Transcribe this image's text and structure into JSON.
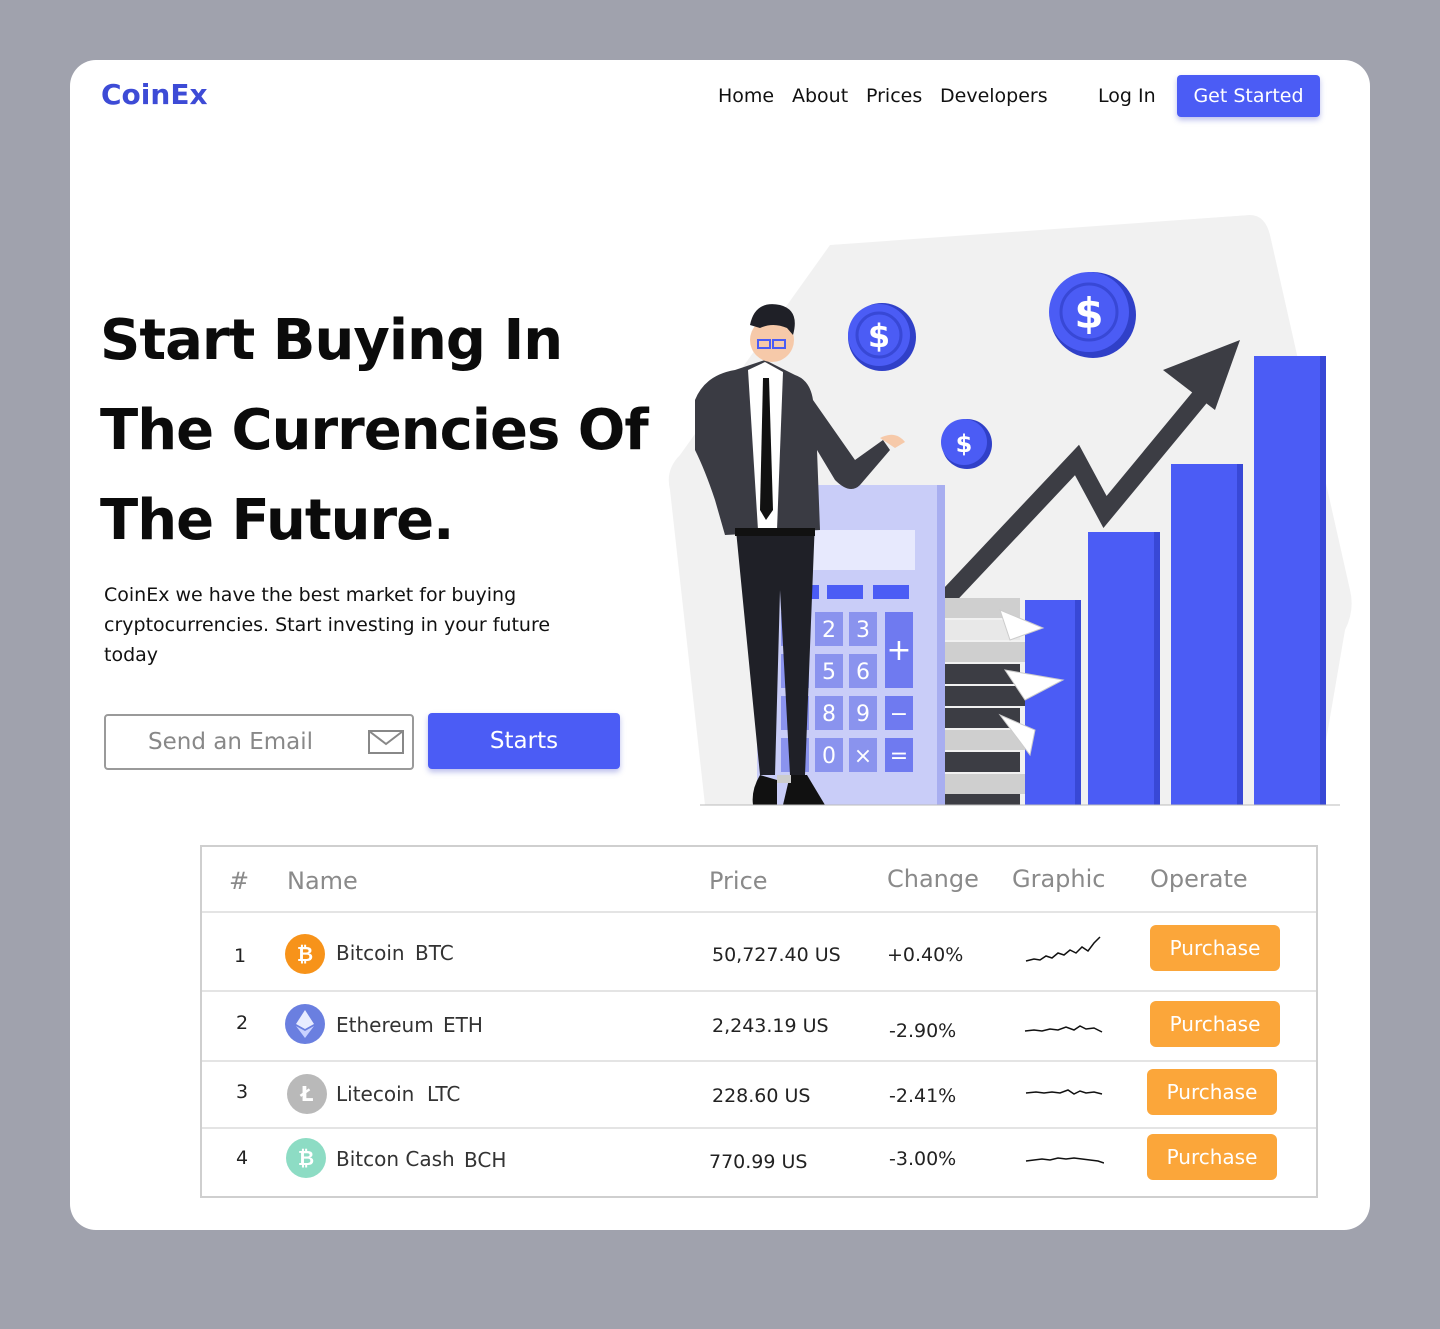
{
  "brand": "CoinEx",
  "nav": {
    "home": "Home",
    "about": "About",
    "prices": "Prices",
    "developers": "Developers",
    "login": "Log In",
    "get_started": "Get Started"
  },
  "hero": {
    "title_line1": "Start Buying In",
    "title_line2": "The Currencies Of",
    "title_line3": "The Future.",
    "subtitle": "CoinEx we have the best market for buying cryptocurrencies. Start investing in your future today",
    "email_placeholder": "Send an Email",
    "start_button": "Starts"
  },
  "table": {
    "headers": {
      "index": "#",
      "name": "Name",
      "price": "Price",
      "change": "Change",
      "graphic": "Graphic",
      "operate": "Operate"
    },
    "rows": [
      {
        "index": "1",
        "name": "Bitcoin",
        "symbol": "BTC",
        "price": "50,727.40 US",
        "change": "+0.40%",
        "icon_color": "#f7931a",
        "icon": "bitcoin-icon",
        "action": "Purchase"
      },
      {
        "index": "2",
        "name": "Ethereum",
        "symbol": "ETH",
        "price": "2,243.19 US",
        "change": "-2.90%",
        "icon_color": "#6a7fe0",
        "icon": "ethereum-icon",
        "action": "Purchase"
      },
      {
        "index": "3",
        "name": "Litecoin",
        "symbol": "LTC",
        "price": "228.60 US",
        "change": "-2.41%",
        "icon_color": "#b9b9b9",
        "icon": "litecoin-icon",
        "action": "Purchase"
      },
      {
        "index": "4",
        "name": "Bitcon Cash",
        "symbol": "BCH",
        "price": "770.99 US",
        "change": "-3.00%",
        "icon_color": "#8ddcc4",
        "icon": "bitcoin-cash-icon",
        "action": "Purchase"
      }
    ]
  },
  "colors": {
    "accent": "#4b5cf5",
    "purchase": "#fba63a",
    "brand": "#3d4bd6"
  }
}
